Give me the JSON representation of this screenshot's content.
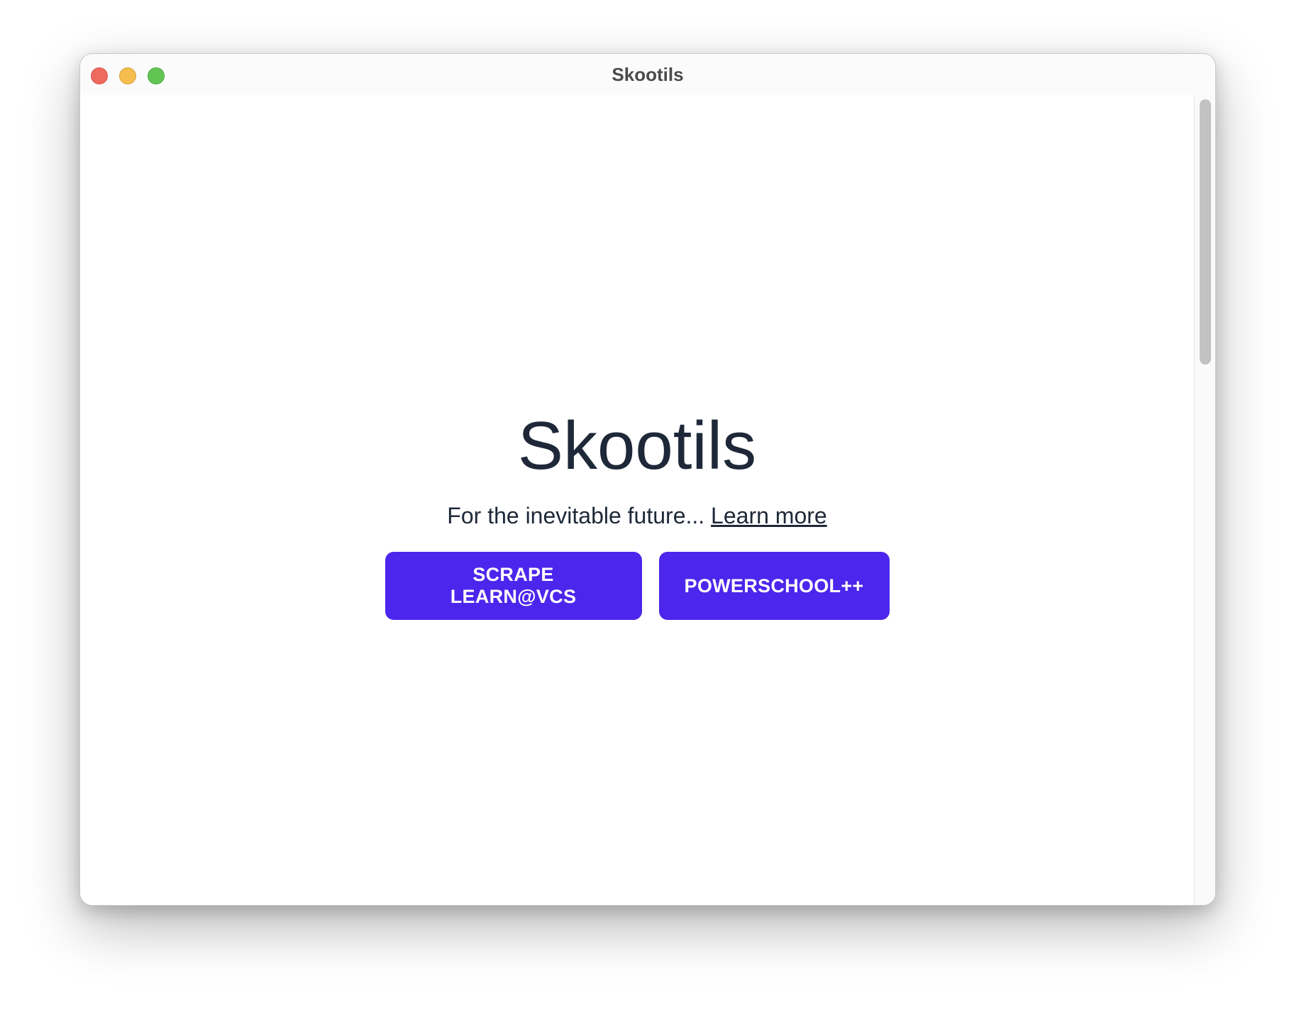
{
  "window": {
    "title": "Skootils",
    "traffic_lights": {
      "close_color": "#ee6a5f",
      "minimize_color": "#f5be4f",
      "maximize_color": "#61c554"
    }
  },
  "main": {
    "heading": "Skootils",
    "tagline": "For the inevitable future...",
    "learn_more_link": "Learn more",
    "buttons": [
      {
        "label": "SCRAPE LEARN@VCS"
      },
      {
        "label": "POWERSCHOOL++"
      }
    ],
    "accent_color": "#4c26ec",
    "text_color": "#1e2838"
  }
}
